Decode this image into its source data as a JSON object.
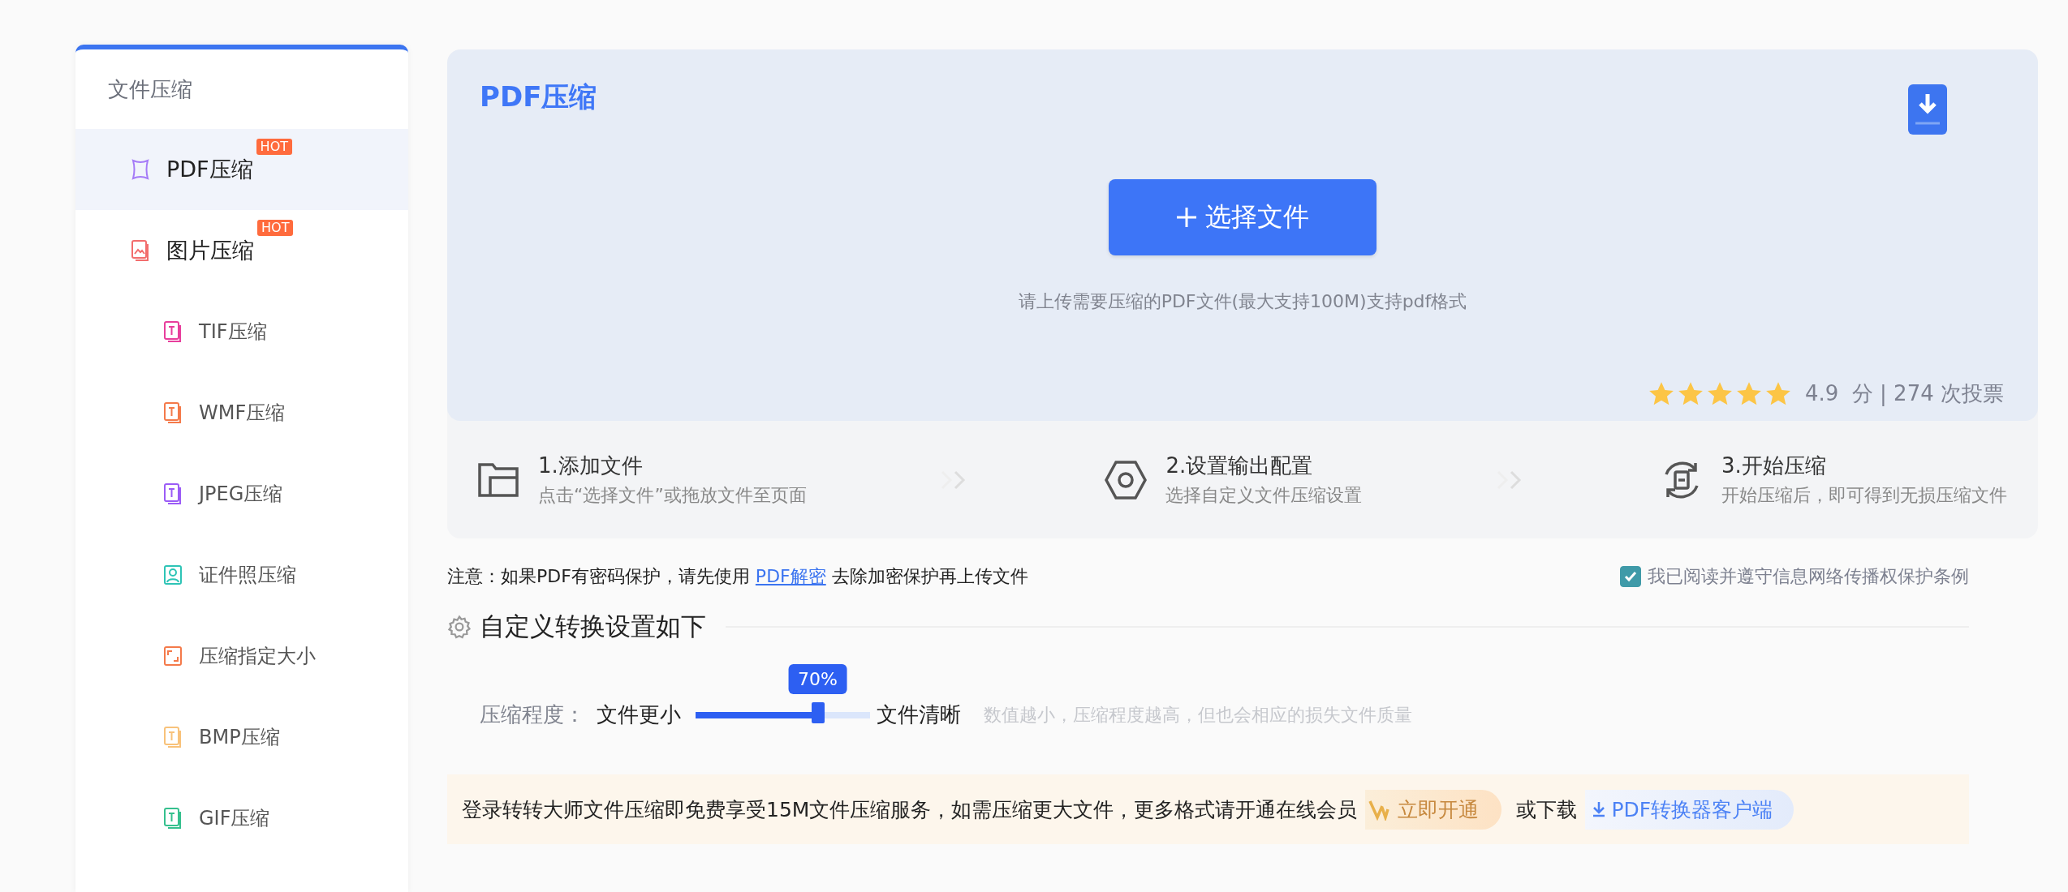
{
  "sidebar": {
    "title": "文件压缩",
    "items": [
      {
        "label": "PDF压缩",
        "badge": "HOT",
        "selected": true,
        "kind": "pdf",
        "color": "#a57bf7"
      },
      {
        "label": "图片压缩",
        "badge": "HOT",
        "selected": false,
        "kind": "image",
        "color": "#f26d6d",
        "children": [
          {
            "label": "TIF压缩",
            "selected": false,
            "kind": "doc",
            "color": "#e83e9c"
          },
          {
            "label": "WMF压缩",
            "selected": false,
            "kind": "doc",
            "color": "#f47a4a"
          },
          {
            "label": "JPEG压缩",
            "selected": false,
            "kind": "doc",
            "color": "#9b5cf6"
          },
          {
            "label": "证件照压缩",
            "selected": false,
            "kind": "person",
            "color": "#2ec4b6"
          },
          {
            "label": "压缩指定大小",
            "selected": false,
            "kind": "resize",
            "color": "#f47a4a"
          },
          {
            "label": "BMP压缩",
            "selected": false,
            "kind": "doc",
            "color": "#f8c27a"
          },
          {
            "label": "GIF压缩",
            "selected": false,
            "kind": "doc",
            "color": "#35c08e"
          }
        ]
      }
    ]
  },
  "panel": {
    "title": "PDF压缩",
    "upload_button": "选择文件",
    "hint": "请上传需要压缩的PDF文件(最大支持100M)支持pdf格式",
    "stars": 5,
    "rating_text": "4.9  分 | 274 次投票"
  },
  "steps": [
    {
      "kind": "folder",
      "title": "1.添加文件",
      "subtitle": "点击“选择文件”或拖放文件至页面"
    },
    {
      "kind": "settings",
      "title": "2.设置输出配置",
      "subtitle": "选择自定义文件压缩设置"
    },
    {
      "kind": "convert",
      "title": "3.开始压缩",
      "subtitle": "开始压缩后，即可得到无损压缩文件"
    }
  ],
  "notice": {
    "before": "注意：如果PDF有密码保护，请先使用 ",
    "link": "PDF解密",
    "after": " 去除加密保护再上传文件"
  },
  "consent": {
    "label": "我已阅读并遵守信息网络传播权保护条例",
    "checked": true
  },
  "settings": {
    "title": "自定义转换设置如下",
    "label": "压缩程度：",
    "min_label": "文件更小",
    "max_label": "文件清晰",
    "tooltip": "70%",
    "level": 0.7,
    "hint": "数值越小，压缩程度越高，但也会相应的损失文件质量"
  },
  "banner": {
    "text": "登录转转大师文件压缩即免费享受15M文件压缩服务，如需压缩更大文件，更多格式请开通在线会员",
    "vip_button": "立即开通",
    "or_text": "或下载",
    "download_link": "PDF转换器客户端"
  }
}
